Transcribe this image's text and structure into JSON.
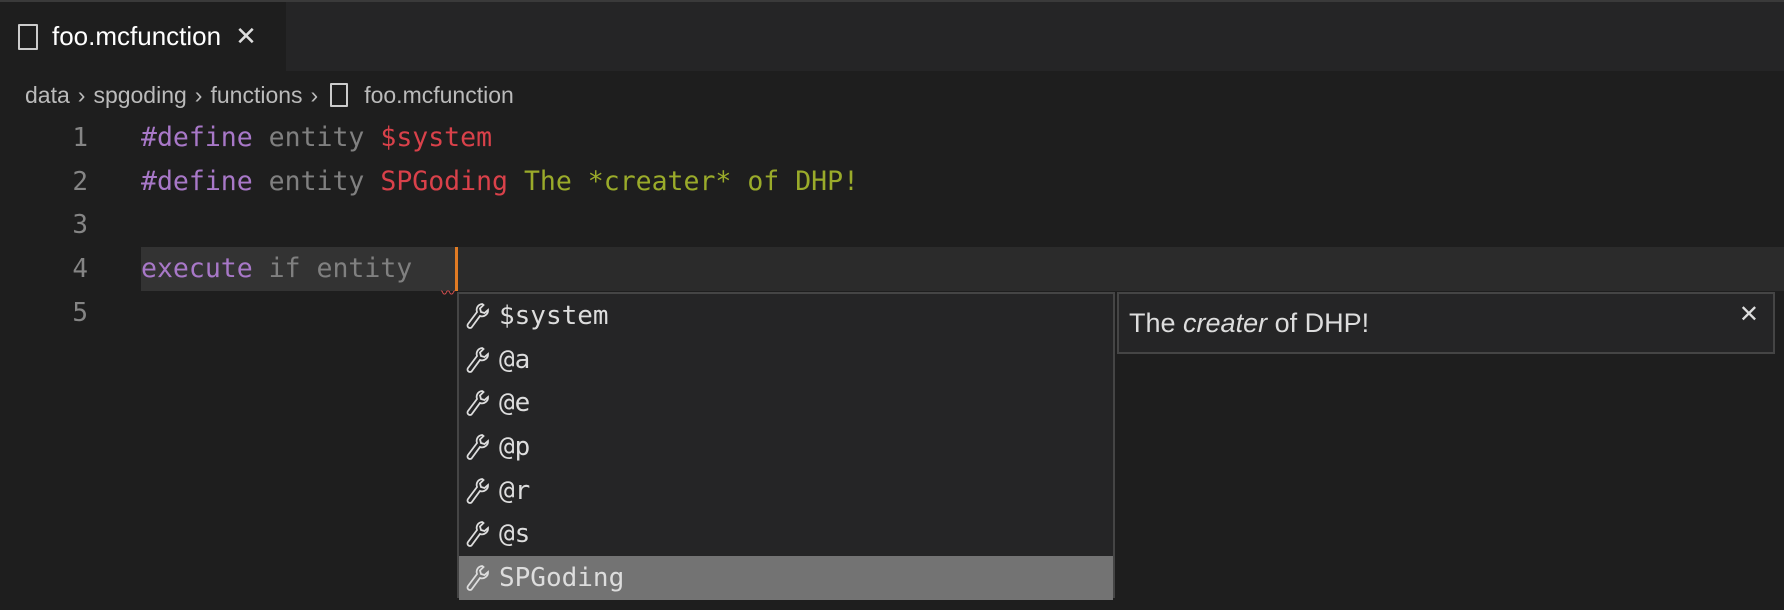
{
  "tab": {
    "name": "foo.mcfunction",
    "close": "✕"
  },
  "breadcrumb": [
    "data",
    "spgoding",
    "functions",
    "foo.mcfunction"
  ],
  "breadcrumb_sep": "›",
  "lines": {
    "n1": "1",
    "n2": "2",
    "n3": "3",
    "n4": "4",
    "n5": "5"
  },
  "code": {
    "l1": {
      "kw": "#define",
      "t": "entity",
      "v": "$system"
    },
    "l2": {
      "kw": "#define",
      "t": "entity",
      "v": "SPGoding",
      "doc": "The *creater* of DHP!"
    },
    "l4": {
      "kw": "execute",
      "t": "if entity"
    }
  },
  "suggestions": [
    "$system",
    "@a",
    "@e",
    "@p",
    "@r",
    "@s",
    "SPGoding"
  ],
  "selected_index": 6,
  "details": {
    "pre": "The",
    "em": "creater",
    "post": "of DHP!",
    "close": "✕"
  },
  "colors": {
    "keyword": "#a878c8",
    "string": "#d9414a",
    "doc": "#9aab2a",
    "cursor": "#e07b24"
  }
}
